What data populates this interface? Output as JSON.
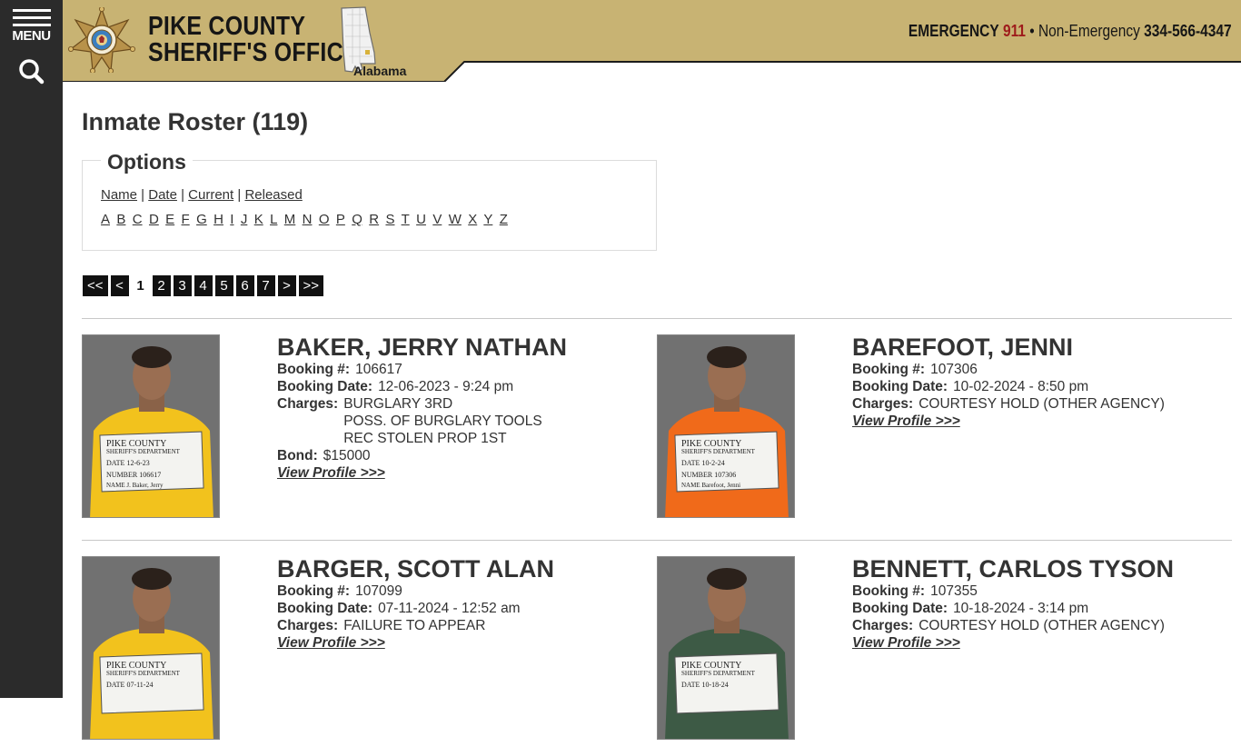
{
  "nav": {
    "menu_label": "MENU",
    "menu_icon": "hamburger-icon",
    "search_icon": "search-icon"
  },
  "header": {
    "office_line1": "PIKE COUNTY",
    "office_line2": "SHERIFF'S OFFICE",
    "state": "Alabama",
    "emergency_label": "EMERGENCY",
    "emergency_number": "911",
    "separator": " • ",
    "nonemergency_label": "Non-Emergency",
    "nonemergency_number": "334-566-4347",
    "colors": {
      "band": "#c8b373",
      "accent": "#9e1b1b"
    }
  },
  "page": {
    "title": "Inmate Roster (119)"
  },
  "options": {
    "legend": "Options",
    "sort_links": [
      "Name",
      "Date",
      "Current",
      "Released"
    ],
    "letters": [
      "A",
      "B",
      "C",
      "D",
      "E",
      "F",
      "G",
      "H",
      "I",
      "J",
      "K",
      "L",
      "M",
      "N",
      "O",
      "P",
      "Q",
      "R",
      "S",
      "T",
      "U",
      "V",
      "W",
      "X",
      "Y",
      "Z"
    ]
  },
  "pager": {
    "first": "<<",
    "prev": "<",
    "pages": [
      "1",
      "2",
      "3",
      "4",
      "5",
      "6",
      "7"
    ],
    "current": "1",
    "next": ">",
    "last": ">>"
  },
  "labels": {
    "booking_no": "Booking #:",
    "booking_date": "Booking Date:",
    "charges": "Charges:",
    "bond": "Bond:",
    "view_profile": "View Profile >>>"
  },
  "inmates": [
    {
      "name": "BAKER, JERRY NATHAN",
      "booking_no": "106617",
      "booking_date": "12-06-2023 - 9:24 pm",
      "charges": [
        "BURGLARY 3RD",
        "POSS. OF BURGLARY TOOLS",
        "REC STOLEN PROP 1ST"
      ],
      "bond": "$15000",
      "shirt_color": "#f2c21d",
      "sign": {
        "line1": "PIKE COUNTY",
        "line2": "SHERIFF'S DEPARTMENT",
        "date": "DATE  12-6-23",
        "number": "NUMBER  106617",
        "name_line": "NAME  J. Baker, Jerry"
      }
    },
    {
      "name": "BAREFOOT, JENNI",
      "booking_no": "107306",
      "booking_date": "10-02-2024 - 8:50 pm",
      "charges": [
        "COURTESY HOLD (OTHER AGENCY)"
      ],
      "bond": "",
      "shirt_color": "#f06a1a",
      "sign": {
        "line1": "PIKE COUNTY",
        "line2": "SHERIFF'S DEPARTMENT",
        "date": "DATE  10-2-24",
        "number": "NUMBER  107306",
        "name_line": "NAME  Barefoot, Jenni"
      }
    },
    {
      "name": "BARGER, SCOTT ALAN",
      "booking_no": "107099",
      "booking_date": "07-11-2024 - 12:52 am",
      "charges": [
        "FAILURE TO APPEAR"
      ],
      "bond": "",
      "shirt_color": "#f2c21d",
      "sign": {
        "line1": "PIKE COUNTY",
        "line2": "SHERIFF'S DEPARTMENT",
        "date": "DATE  07-11-24",
        "number": "",
        "name_line": ""
      }
    },
    {
      "name": "BENNETT, CARLOS TYSON",
      "booking_no": "107355",
      "booking_date": "10-18-2024 - 3:14 pm",
      "charges": [
        "COURTESY HOLD (OTHER AGENCY)"
      ],
      "bond": "",
      "shirt_color": "#3d5a45",
      "sign": {
        "line1": "PIKE COUNTY",
        "line2": "SHERIFF'S DEPARTMENT",
        "date": "DATE  10-18-24",
        "number": "",
        "name_line": ""
      }
    }
  ]
}
